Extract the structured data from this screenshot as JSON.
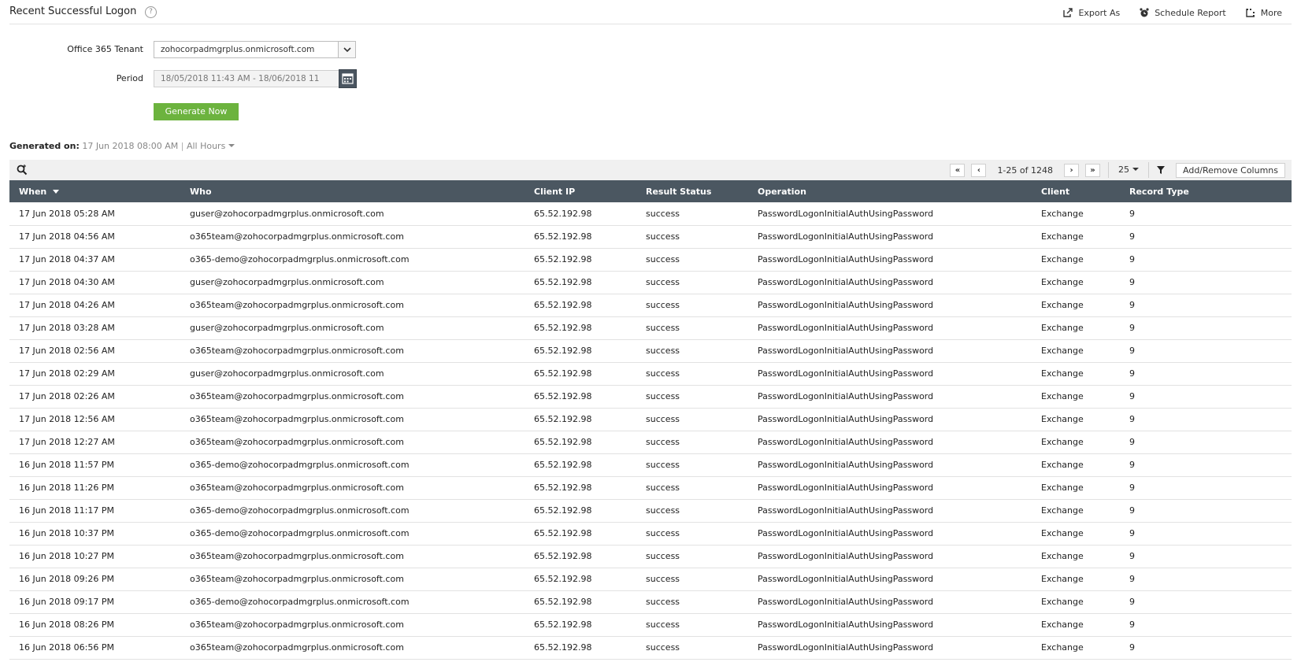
{
  "header": {
    "title": "Recent Successful Logon",
    "help_icon": "?",
    "actions": [
      {
        "label": "Export As",
        "icon": "export-icon"
      },
      {
        "label": "Schedule Report",
        "icon": "alarm-clock-icon"
      },
      {
        "label": "More",
        "icon": "more-icon"
      }
    ]
  },
  "form": {
    "tenant_label": "Office 365 Tenant",
    "tenant_value": "zohocorpadmgrplus.onmicrosoft.com",
    "period_label": "Period",
    "period_value": "18/05/2018 11:43 AM - 18/06/2018 11",
    "generate_label": "Generate Now"
  },
  "generated": {
    "label": "Generated on:",
    "value": "17 Jun 2018 08:00 AM",
    "separator": "|",
    "hours": "All Hours"
  },
  "toolbar": {
    "page_info": "1-25 of 1248",
    "page_size": "25",
    "first": "«",
    "prev": "‹",
    "next": "›",
    "last": "»",
    "add_remove_label": "Add/Remove Columns"
  },
  "table": {
    "columns": [
      "When",
      "Who",
      "Client IP",
      "Result Status",
      "Operation",
      "Client",
      "Record Type"
    ],
    "rows": [
      [
        "17 Jun 2018 05:28 AM",
        "guser@zohocorpadmgrplus.onmicrosoft.com",
        "65.52.192.98",
        "success",
        "PasswordLogonInitialAuthUsingPassword",
        "Exchange",
        "9"
      ],
      [
        "17 Jun 2018 04:56 AM",
        "o365team@zohocorpadmgrplus.onmicrosoft.com",
        "65.52.192.98",
        "success",
        "PasswordLogonInitialAuthUsingPassword",
        "Exchange",
        "9"
      ],
      [
        "17 Jun 2018 04:37 AM",
        "o365-demo@zohocorpadmgrplus.onmicrosoft.com",
        "65.52.192.98",
        "success",
        "PasswordLogonInitialAuthUsingPassword",
        "Exchange",
        "9"
      ],
      [
        "17 Jun 2018 04:30 AM",
        "guser@zohocorpadmgrplus.onmicrosoft.com",
        "65.52.192.98",
        "success",
        "PasswordLogonInitialAuthUsingPassword",
        "Exchange",
        "9"
      ],
      [
        "17 Jun 2018 04:26 AM",
        "o365team@zohocorpadmgrplus.onmicrosoft.com",
        "65.52.192.98",
        "success",
        "PasswordLogonInitialAuthUsingPassword",
        "Exchange",
        "9"
      ],
      [
        "17 Jun 2018 03:28 AM",
        "guser@zohocorpadmgrplus.onmicrosoft.com",
        "65.52.192.98",
        "success",
        "PasswordLogonInitialAuthUsingPassword",
        "Exchange",
        "9"
      ],
      [
        "17 Jun 2018 02:56 AM",
        "o365team@zohocorpadmgrplus.onmicrosoft.com",
        "65.52.192.98",
        "success",
        "PasswordLogonInitialAuthUsingPassword",
        "Exchange",
        "9"
      ],
      [
        "17 Jun 2018 02:29 AM",
        "guser@zohocorpadmgrplus.onmicrosoft.com",
        "65.52.192.98",
        "success",
        "PasswordLogonInitialAuthUsingPassword",
        "Exchange",
        "9"
      ],
      [
        "17 Jun 2018 02:26 AM",
        "o365team@zohocorpadmgrplus.onmicrosoft.com",
        "65.52.192.98",
        "success",
        "PasswordLogonInitialAuthUsingPassword",
        "Exchange",
        "9"
      ],
      [
        "17 Jun 2018 12:56 AM",
        "o365team@zohocorpadmgrplus.onmicrosoft.com",
        "65.52.192.98",
        "success",
        "PasswordLogonInitialAuthUsingPassword",
        "Exchange",
        "9"
      ],
      [
        "17 Jun 2018 12:27 AM",
        "o365team@zohocorpadmgrplus.onmicrosoft.com",
        "65.52.192.98",
        "success",
        "PasswordLogonInitialAuthUsingPassword",
        "Exchange",
        "9"
      ],
      [
        "16 Jun 2018 11:57 PM",
        "o365-demo@zohocorpadmgrplus.onmicrosoft.com",
        "65.52.192.98",
        "success",
        "PasswordLogonInitialAuthUsingPassword",
        "Exchange",
        "9"
      ],
      [
        "16 Jun 2018 11:26 PM",
        "o365team@zohocorpadmgrplus.onmicrosoft.com",
        "65.52.192.98",
        "success",
        "PasswordLogonInitialAuthUsingPassword",
        "Exchange",
        "9"
      ],
      [
        "16 Jun 2018 11:17 PM",
        "o365-demo@zohocorpadmgrplus.onmicrosoft.com",
        "65.52.192.98",
        "success",
        "PasswordLogonInitialAuthUsingPassword",
        "Exchange",
        "9"
      ],
      [
        "16 Jun 2018 10:37 PM",
        "o365-demo@zohocorpadmgrplus.onmicrosoft.com",
        "65.52.192.98",
        "success",
        "PasswordLogonInitialAuthUsingPassword",
        "Exchange",
        "9"
      ],
      [
        "16 Jun 2018 10:27 PM",
        "o365team@zohocorpadmgrplus.onmicrosoft.com",
        "65.52.192.98",
        "success",
        "PasswordLogonInitialAuthUsingPassword",
        "Exchange",
        "9"
      ],
      [
        "16 Jun 2018 09:26 PM",
        "o365team@zohocorpadmgrplus.onmicrosoft.com",
        "65.52.192.98",
        "success",
        "PasswordLogonInitialAuthUsingPassword",
        "Exchange",
        "9"
      ],
      [
        "16 Jun 2018 09:17 PM",
        "o365-demo@zohocorpadmgrplus.onmicrosoft.com",
        "65.52.192.98",
        "success",
        "PasswordLogonInitialAuthUsingPassword",
        "Exchange",
        "9"
      ],
      [
        "16 Jun 2018 08:26 PM",
        "o365team@zohocorpadmgrplus.onmicrosoft.com",
        "65.52.192.98",
        "success",
        "PasswordLogonInitialAuthUsingPassword",
        "Exchange",
        "9"
      ],
      [
        "16 Jun 2018 06:56 PM",
        "o365team@zohocorpadmgrplus.onmicrosoft.com",
        "65.52.192.98",
        "success",
        "PasswordLogonInitialAuthUsingPassword",
        "Exchange",
        "9"
      ]
    ]
  },
  "colors": {
    "accent_green": "#6cb33e",
    "header_dark": "#4b5761"
  }
}
